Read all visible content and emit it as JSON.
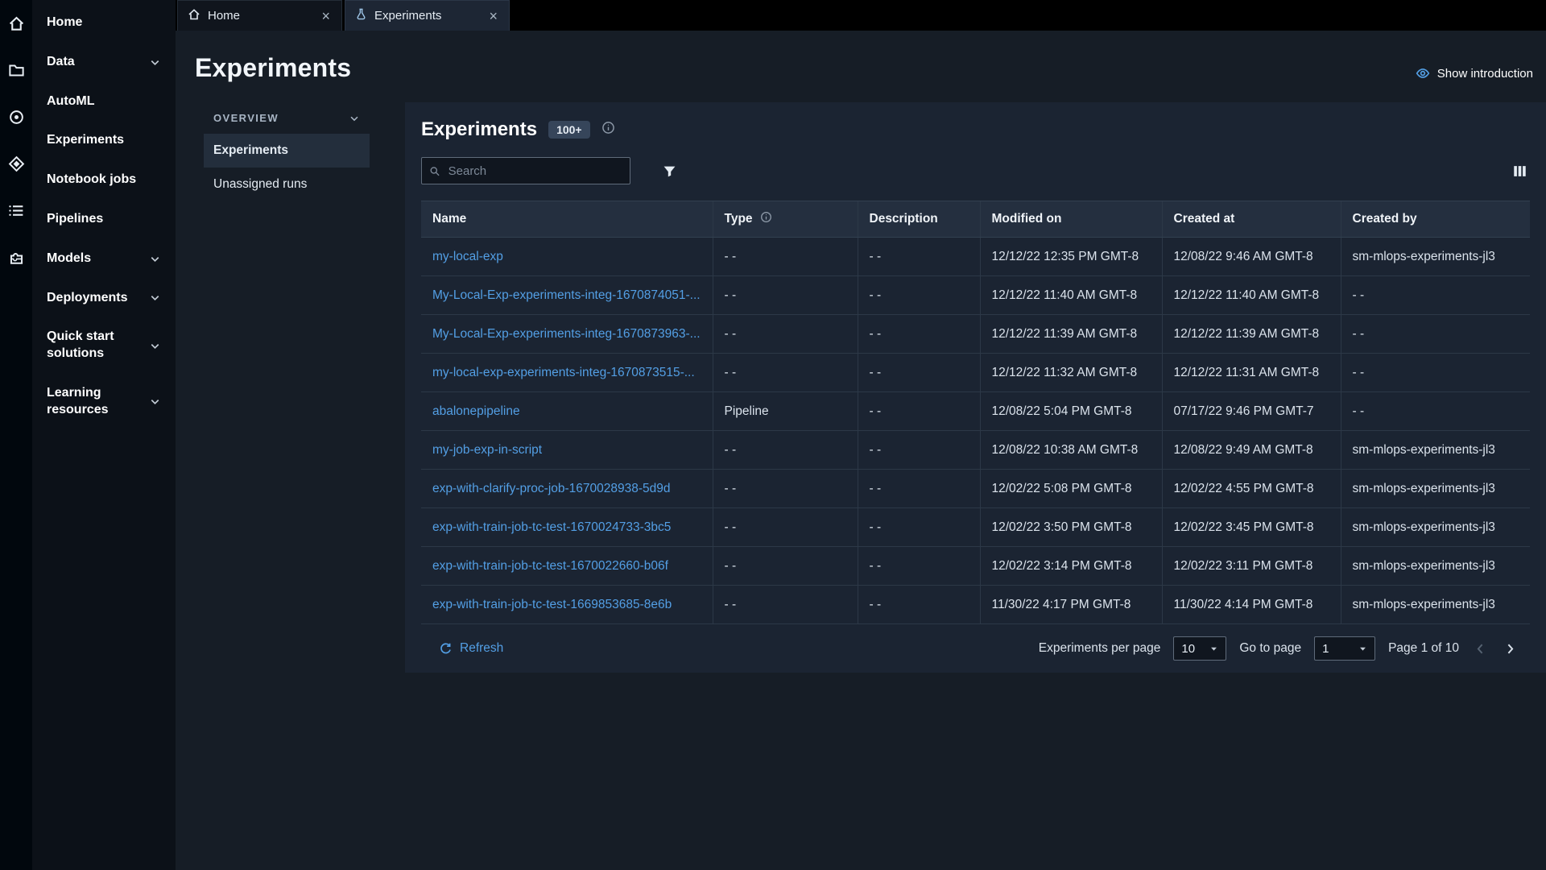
{
  "icon_rail": {
    "icons": [
      "home",
      "data-folder",
      "automl",
      "experiments",
      "notebook-jobs",
      "pipelines"
    ]
  },
  "sidebar": {
    "items": [
      {
        "label": "Home",
        "chevron": false
      },
      {
        "label": "Data",
        "chevron": true
      },
      {
        "label": "AutoML",
        "chevron": false
      },
      {
        "label": "Experiments",
        "chevron": false
      },
      {
        "label": "Notebook jobs",
        "chevron": false
      },
      {
        "label": "Pipelines",
        "chevron": false
      },
      {
        "label": "Models",
        "chevron": true
      },
      {
        "label": "Deployments",
        "chevron": true
      },
      {
        "label": "Quick start solutions",
        "chevron": true
      },
      {
        "label": "Learning resources",
        "chevron": true
      }
    ]
  },
  "tabs": {
    "home": "Home",
    "experiments": "Experiments"
  },
  "header": {
    "title": "Experiments",
    "show_introduction": "Show introduction"
  },
  "subnav": {
    "section": "OVERVIEW",
    "items": [
      "Experiments",
      "Unassigned runs"
    ]
  },
  "panel": {
    "title": "Experiments",
    "badge": "100+",
    "search_placeholder": "Search"
  },
  "table": {
    "columns": [
      "Name",
      "Type",
      "Description",
      "Modified on",
      "Created at",
      "Created by"
    ],
    "rows": [
      [
        "my-local-exp",
        "- -",
        "- -",
        "12/12/22 12:35 PM GMT-8",
        "12/08/22 9:46 AM GMT-8",
        "sm-mlops-experiments-jl3"
      ],
      [
        "My-Local-Exp-experiments-integ-1670874051-...",
        "- -",
        "- -",
        "12/12/22 11:40 AM GMT-8",
        "12/12/22 11:40 AM GMT-8",
        "- -"
      ],
      [
        "My-Local-Exp-experiments-integ-1670873963-...",
        "- -",
        "- -",
        "12/12/22 11:39 AM GMT-8",
        "12/12/22 11:39 AM GMT-8",
        "- -"
      ],
      [
        "my-local-exp-experiments-integ-1670873515-...",
        "- -",
        "- -",
        "12/12/22 11:32 AM GMT-8",
        "12/12/22 11:31 AM GMT-8",
        "- -"
      ],
      [
        "abalonepipeline",
        "Pipeline",
        "- -",
        "12/08/22 5:04 PM GMT-8",
        "07/17/22 9:46 PM GMT-7",
        "- -"
      ],
      [
        "my-job-exp-in-script",
        "- -",
        "- -",
        "12/08/22 10:38 AM GMT-8",
        "12/08/22 9:49 AM GMT-8",
        "sm-mlops-experiments-jl3"
      ],
      [
        "exp-with-clarify-proc-job-1670028938-5d9d",
        "- -",
        "- -",
        "12/02/22 5:08 PM GMT-8",
        "12/02/22 4:55 PM GMT-8",
        "sm-mlops-experiments-jl3"
      ],
      [
        "exp-with-train-job-tc-test-1670024733-3bc5",
        "- -",
        "- -",
        "12/02/22 3:50 PM GMT-8",
        "12/02/22 3:45 PM GMT-8",
        "sm-mlops-experiments-jl3"
      ],
      [
        "exp-with-train-job-tc-test-1670022660-b06f",
        "- -",
        "- -",
        "12/02/22 3:14 PM GMT-8",
        "12/02/22 3:11 PM GMT-8",
        "sm-mlops-experiments-jl3"
      ],
      [
        "exp-with-train-job-tc-test-1669853685-8e6b",
        "- -",
        "- -",
        "11/30/22 4:17 PM GMT-8",
        "11/30/22 4:14 PM GMT-8",
        "sm-mlops-experiments-jl3"
      ]
    ]
  },
  "footer": {
    "refresh": "Refresh",
    "per_page_label": "Experiments per page",
    "per_page_value": "10",
    "goto_label": "Go to page",
    "goto_value": "1",
    "page_status": "Page 1 of 10"
  },
  "colors": {
    "accent_link": "#539fe5",
    "card_bg": "#1b2432",
    "page_bg": "#161d26",
    "sidebar_bg": "#0c1118"
  }
}
